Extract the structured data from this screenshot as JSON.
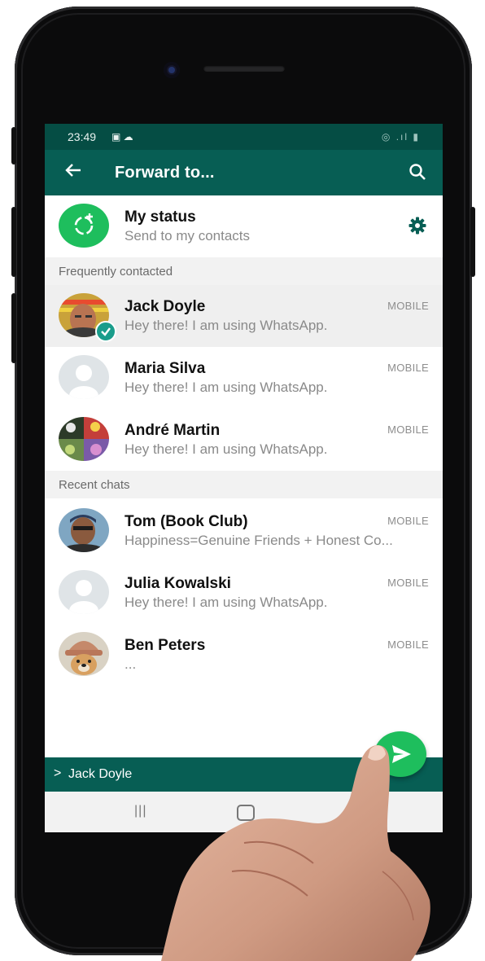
{
  "status_bar": {
    "time": "23:49",
    "left_icons": "▣ ☁",
    "right_icons": "◎ .ıl ▮"
  },
  "app_bar": {
    "back_icon": "arrow-left-icon",
    "title": "Forward to...",
    "search_icon": "search-icon"
  },
  "my_status": {
    "name": "My status",
    "subtitle": "Send to my contacts",
    "settings_icon": "gear-icon"
  },
  "sections": {
    "frequent": "Frequently contacted",
    "recent": "Recent chats"
  },
  "frequent_contacts": [
    {
      "name": "Jack Doyle",
      "status": "Hey there! I am using WhatsApp.",
      "type": "MOBILE",
      "selected": true
    },
    {
      "name": "Maria Silva",
      "status": "Hey there! I am using WhatsApp.",
      "type": "MOBILE",
      "selected": false
    },
    {
      "name": "André Martin",
      "status": "Hey there! I am using WhatsApp.",
      "type": "MOBILE",
      "selected": false
    }
  ],
  "recent_chats": [
    {
      "name": "Tom (Book Club)",
      "status": "Happiness=Genuine Friends + Honest Co...",
      "type": "MOBILE"
    },
    {
      "name": "Julia Kowalski",
      "status": "Hey there! I am using WhatsApp.",
      "type": "MOBILE"
    },
    {
      "name": "Ben Peters",
      "status": "...",
      "type": "MOBILE"
    }
  ],
  "selection_bar": {
    "chevron": ">",
    "selected_name": "Jack Doyle"
  },
  "send_button": {
    "icon": "send-icon"
  },
  "nav_bar": {
    "recents_icon": "|||",
    "home_icon": "home-icon"
  },
  "colors": {
    "primary": "#075e54",
    "status_bar": "#054d44",
    "accent": "#1ebe5d",
    "checkmark": "#1a9d8b"
  }
}
